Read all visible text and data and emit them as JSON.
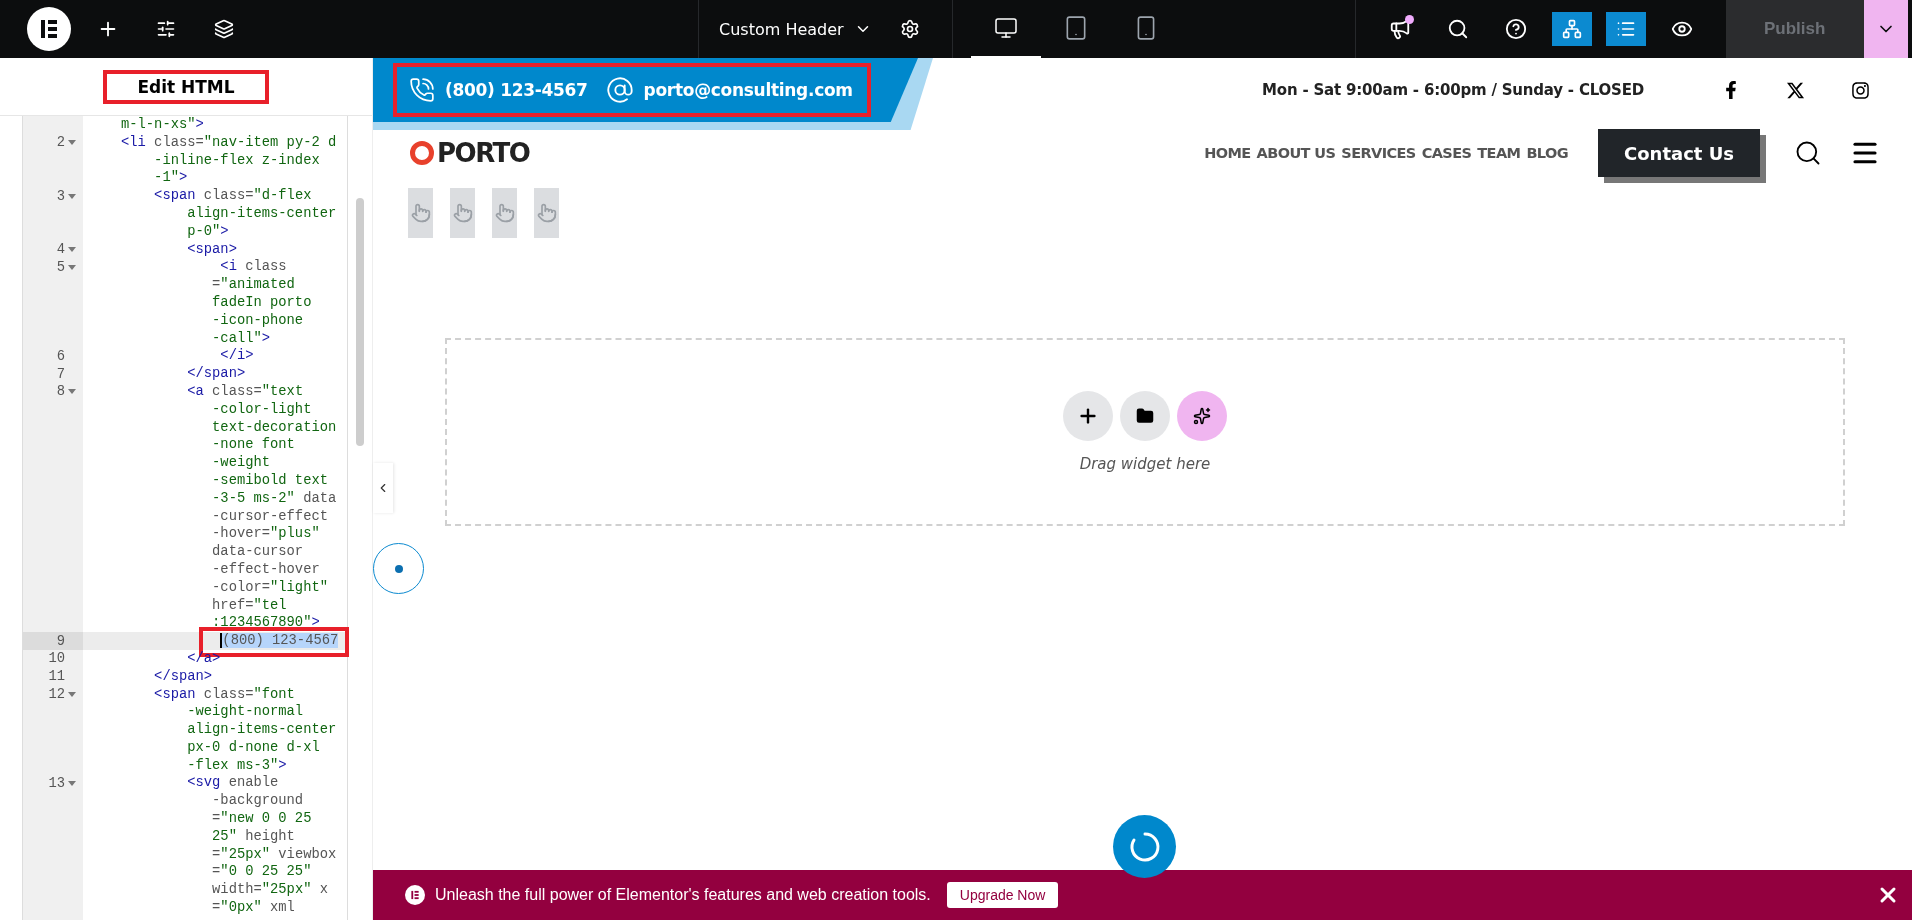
{
  "top_bar": {
    "document_title": "Custom Header",
    "notification_dot": true,
    "devices": [
      {
        "kind": "desktop",
        "selected": true
      },
      {
        "kind": "tablet",
        "selected": false
      },
      {
        "kind": "mobile",
        "selected": false
      }
    ],
    "toggles": [
      {
        "kind": "structure",
        "on": true
      },
      {
        "kind": "navigator",
        "on": true
      }
    ],
    "publish": {
      "label": "Publish",
      "disabled": true
    }
  },
  "panel": {
    "title": "Edit HTML",
    "highlighted": true,
    "code_lines": [
      {
        "tokens": [
          {
            "kind": "string",
            "text": "m-l-n-xs\""
          },
          {
            "kind": "tag",
            "text": ">"
          }
        ]
      },
      {
        "number": "2",
        "fold": true,
        "tokens": [
          {
            "kind": "tag",
            "text": "<li"
          },
          {
            "kind": "attr",
            "text": " class="
          },
          {
            "kind": "string",
            "text": "\"nav-item py-2 d"
          }
        ]
      },
      {
        "tokens": [
          {
            "kind": "string",
            "text": "    -inline-flex z-index"
          }
        ]
      },
      {
        "tokens": [
          {
            "kind": "string",
            "text": "    -1\""
          },
          {
            "kind": "tag",
            "text": ">"
          }
        ]
      },
      {
        "number": "3",
        "fold": true,
        "tokens": [
          {
            "kind": "tag",
            "text": "    <span"
          },
          {
            "kind": "attr",
            "text": " class="
          },
          {
            "kind": "string",
            "text": "\"d-flex"
          }
        ]
      },
      {
        "tokens": [
          {
            "kind": "string",
            "text": "        align-items-center"
          }
        ]
      },
      {
        "tokens": [
          {
            "kind": "string",
            "text": "        p-0\""
          },
          {
            "kind": "tag",
            "text": ">"
          }
        ]
      },
      {
        "number": "4",
        "fold": true,
        "tokens": [
          {
            "kind": "tag",
            "text": "        <span>"
          }
        ]
      },
      {
        "number": "5",
        "fold": true,
        "tokens": [
          {
            "kind": "tag",
            "text": "            <i"
          },
          {
            "kind": "attr",
            "text": " class"
          }
        ]
      },
      {
        "tokens": [
          {
            "kind": "attr",
            "text": "           ="
          },
          {
            "kind": "string",
            "text": "\"animated"
          }
        ]
      },
      {
        "tokens": [
          {
            "kind": "string",
            "text": "           fadeIn porto"
          }
        ]
      },
      {
        "tokens": [
          {
            "kind": "string",
            "text": "           -icon-phone"
          }
        ]
      },
      {
        "tokens": [
          {
            "kind": "string",
            "text": "           -call\""
          },
          {
            "kind": "tag",
            "text": ">"
          }
        ]
      },
      {
        "number": "6",
        "tokens": [
          {
            "kind": "tag",
            "text": "            </i>"
          }
        ]
      },
      {
        "number": "7",
        "tokens": [
          {
            "kind": "tag",
            "text": "        </span>"
          }
        ]
      },
      {
        "number": "8",
        "fold": true,
        "tokens": [
          {
            "kind": "tag",
            "text": "        <a"
          },
          {
            "kind": "attr",
            "text": " class="
          },
          {
            "kind": "string",
            "text": "\"text"
          }
        ]
      },
      {
        "tokens": [
          {
            "kind": "string",
            "text": "           -color-light"
          }
        ]
      },
      {
        "tokens": [
          {
            "kind": "string",
            "text": "           text-decoration"
          }
        ]
      },
      {
        "tokens": [
          {
            "kind": "string",
            "text": "           -none font"
          }
        ]
      },
      {
        "tokens": [
          {
            "kind": "string",
            "text": "           -weight"
          }
        ]
      },
      {
        "tokens": [
          {
            "kind": "string",
            "text": "           -semibold text"
          }
        ]
      },
      {
        "tokens": [
          {
            "kind": "string",
            "text": "           -3-5 ms-2\""
          },
          {
            "kind": "attr",
            "text": " data"
          }
        ]
      },
      {
        "tokens": [
          {
            "kind": "attr",
            "text": "           -cursor-effect"
          }
        ]
      },
      {
        "tokens": [
          {
            "kind": "attr",
            "text": "           -hover="
          },
          {
            "kind": "string",
            "text": "\"plus\""
          }
        ]
      },
      {
        "tokens": [
          {
            "kind": "attr",
            "text": "           data-cursor"
          }
        ]
      },
      {
        "tokens": [
          {
            "kind": "attr",
            "text": "           -effect-hover"
          }
        ]
      },
      {
        "tokens": [
          {
            "kind": "attr",
            "text": "           -color="
          },
          {
            "kind": "string",
            "text": "\"light\""
          }
        ]
      },
      {
        "tokens": [
          {
            "kind": "attr",
            "text": "           href="
          },
          {
            "kind": "string",
            "text": "\"tel"
          }
        ]
      },
      {
        "tokens": [
          {
            "kind": "string",
            "text": "           :1234567890\""
          },
          {
            "kind": "tag",
            "text": ">"
          }
        ]
      },
      {
        "number": "9",
        "selected": true,
        "annotated": true,
        "tokens": [
          {
            "kind": "selection",
            "text": "            (800) 123-4567"
          }
        ]
      },
      {
        "number": "10",
        "tokens": [
          {
            "kind": "tag",
            "text": "        </a>"
          }
        ]
      },
      {
        "number": "11",
        "tokens": [
          {
            "kind": "tag",
            "text": "    </span>"
          }
        ]
      },
      {
        "number": "12",
        "fold": true,
        "tokens": [
          {
            "kind": "tag",
            "text": "    <span"
          },
          {
            "kind": "attr",
            "text": " class="
          },
          {
            "kind": "string",
            "text": "\"font"
          }
        ]
      },
      {
        "tokens": [
          {
            "kind": "string",
            "text": "        -weight-normal"
          }
        ]
      },
      {
        "tokens": [
          {
            "kind": "string",
            "text": "        align-items-center"
          }
        ]
      },
      {
        "tokens": [
          {
            "kind": "string",
            "text": "        px-0 d-none d-xl"
          }
        ]
      },
      {
        "tokens": [
          {
            "kind": "string",
            "text": "        -flex ms-3\""
          },
          {
            "kind": "tag",
            "text": ">"
          }
        ]
      },
      {
        "number": "13",
        "fold": true,
        "tokens": [
          {
            "kind": "tag",
            "text": "        <svg"
          },
          {
            "kind": "attr",
            "text": " enable"
          }
        ]
      },
      {
        "tokens": [
          {
            "kind": "attr",
            "text": "           -background"
          }
        ]
      },
      {
        "tokens": [
          {
            "kind": "attr",
            "text": "           ="
          },
          {
            "kind": "string",
            "text": "\"new 0 0 25"
          }
        ]
      },
      {
        "tokens": [
          {
            "kind": "string",
            "text": "           25\""
          },
          {
            "kind": "attr",
            "text": " height"
          }
        ]
      },
      {
        "tokens": [
          {
            "kind": "attr",
            "text": "           ="
          },
          {
            "kind": "string",
            "text": "\"25px\""
          },
          {
            "kind": "attr",
            "text": " viewbox"
          }
        ]
      },
      {
        "tokens": [
          {
            "kind": "attr",
            "text": "           ="
          },
          {
            "kind": "string",
            "text": "\"0 0 25 25\""
          }
        ]
      },
      {
        "tokens": [
          {
            "kind": "attr",
            "text": "           width="
          },
          {
            "kind": "string",
            "text": "\"25px\""
          },
          {
            "kind": "attr",
            "text": " x"
          }
        ]
      },
      {
        "tokens": [
          {
            "kind": "attr",
            "text": "           ="
          },
          {
            "kind": "string",
            "text": "\"0px\""
          },
          {
            "kind": "attr",
            "text": " xml"
          }
        ]
      }
    ]
  },
  "preview": {
    "contact_bar": {
      "highlighted": true,
      "phone": "(800) 123-4567",
      "email": "porto@consulting.com",
      "hours": "Mon - Sat 9:00am - 6:00pm / Sunday - CLOSED"
    },
    "logo": "PORTO",
    "nav": [
      "HOME",
      "ABOUT US",
      "SERVICES",
      "CASES",
      "TEAM",
      "BLOG"
    ],
    "cta": "Contact Us",
    "dropzone": {
      "hint": "Drag widget here"
    }
  },
  "promo_banner": {
    "text": "Unleash the full power of Elementor's features and web creation tools.",
    "button": "Upgrade Now"
  }
}
